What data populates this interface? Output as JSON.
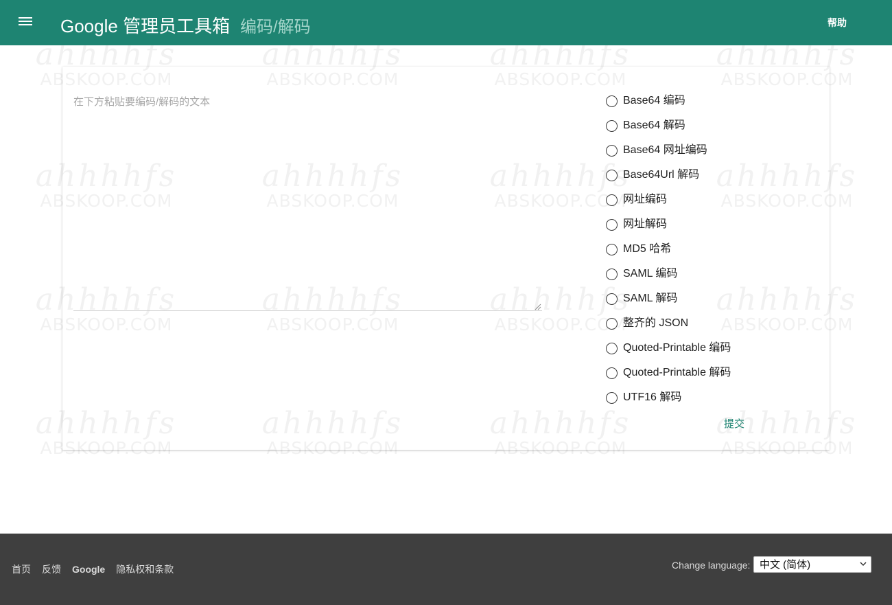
{
  "header": {
    "app_title": "Google 管理员工具箱",
    "page_title": "编码/解码",
    "help_label": "帮助"
  },
  "editor": {
    "placeholder": "在下方粘贴要编码/解码的文本"
  },
  "options": [
    {
      "label": "Base64 编码",
      "selected": false
    },
    {
      "label": "Base64 解码",
      "selected": false
    },
    {
      "label": "Base64 网址编码",
      "selected": false
    },
    {
      "label": "Base64Url 解码",
      "selected": false
    },
    {
      "label": "网址编码",
      "selected": false
    },
    {
      "label": "网址解码",
      "selected": false
    },
    {
      "label": "MD5 哈希",
      "selected": false
    },
    {
      "label": "SAML 编码",
      "selected": false
    },
    {
      "label": "SAML 解码",
      "selected": false
    },
    {
      "label": "整齐的 JSON",
      "selected": false
    },
    {
      "label": "Quoted-Printable 编码",
      "selected": false
    },
    {
      "label": "Quoted-Printable 解码",
      "selected": false
    },
    {
      "label": "UTF16 解码",
      "selected": false
    }
  ],
  "submit_label": "提交",
  "footer": {
    "links": [
      "首页",
      "反馈",
      "Google",
      "隐私权和条款"
    ],
    "language_label": "Change language:",
    "language_value": "中文 (简体)"
  },
  "watermark": {
    "main": "ahhhhfs",
    "sub": "ABSKOOP.COM"
  },
  "colors": {
    "header": "#1e8472",
    "footer": "#3f3f3f",
    "accent": "#1e8472"
  }
}
